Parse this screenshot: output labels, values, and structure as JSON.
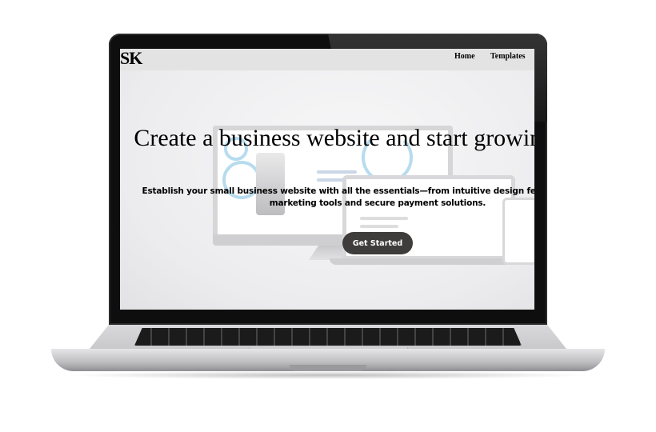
{
  "site": {
    "logo": "SK",
    "nav": [
      {
        "label": "Home"
      },
      {
        "label": "Templates"
      }
    ]
  },
  "hero": {
    "title": "Create a business website and start growing online",
    "subtitle": "Establish your small business website with all the essentials—from intuitive design features to built-in marketing tools and secure payment solutions.",
    "cta_label": "Get Started"
  },
  "colors": {
    "nav_bg": "#e3e3e3",
    "cta_bg": "#3f3c3c",
    "cta_text": "#ffffff",
    "accent_ring": "#b7dcee"
  }
}
